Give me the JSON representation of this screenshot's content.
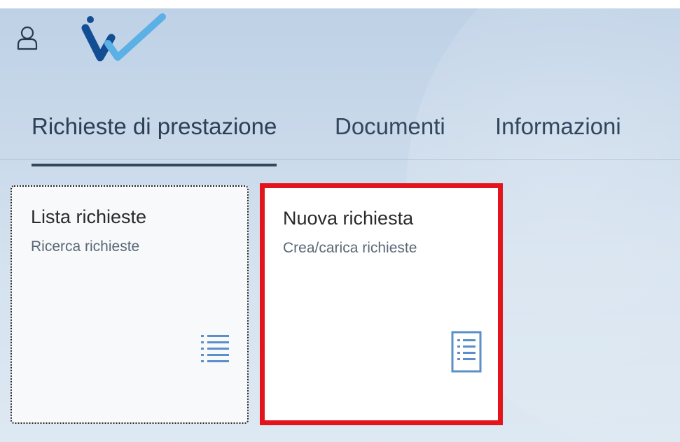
{
  "header": {
    "user_icon": "user-icon",
    "logo": "brand-logo"
  },
  "tabs": [
    {
      "label": "Richieste di prestazione",
      "active": true
    },
    {
      "label": "Documenti",
      "active": false
    },
    {
      "label": "Informazioni",
      "active": false
    }
  ],
  "tiles": [
    {
      "title": "Lista richieste",
      "subtitle": "Ricerca richieste",
      "icon": "list-icon",
      "highlighted": false
    },
    {
      "title": "Nuova richiesta",
      "subtitle": "Crea/carica richieste",
      "icon": "document-icon",
      "highlighted": true
    }
  ],
  "colors": {
    "accent": "#32465d",
    "highlight": "#e3141b",
    "icon": "#5b8fc9",
    "logo_dark": "#124e93",
    "logo_light": "#5bb0e6"
  }
}
